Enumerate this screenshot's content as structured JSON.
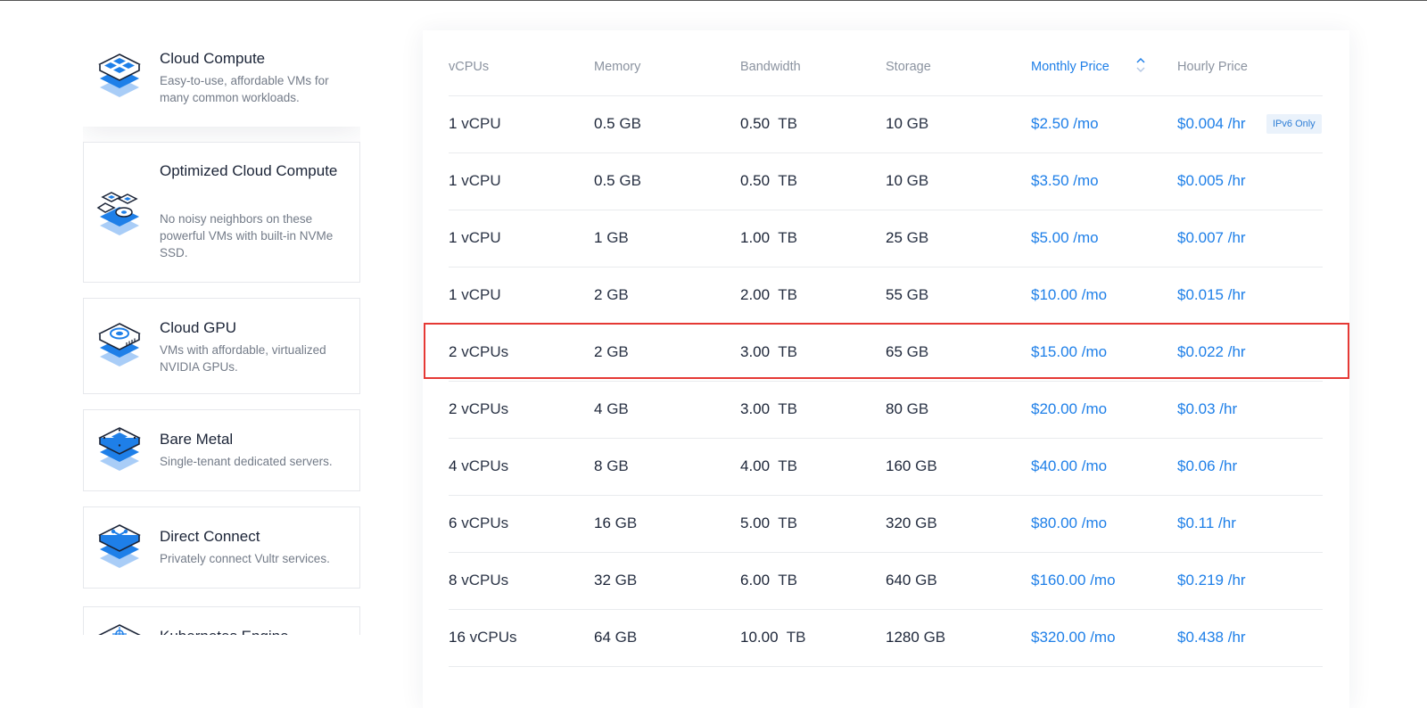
{
  "sidebar": {
    "items": [
      {
        "title": "Cloud Compute",
        "description": "Easy-to-use, affordable VMs for many common workloads.",
        "icon": "cloud-compute-icon",
        "active": true
      },
      {
        "title": "Optimized Cloud Compute",
        "description": "No noisy neighbors on these powerful VMs with built-in NVMe SSD.",
        "icon": "optimized-compute-icon",
        "active": false
      },
      {
        "title": "Cloud GPU",
        "description": "VMs with affordable, virtualized NVIDIA GPUs.",
        "icon": "gpu-icon",
        "active": false
      },
      {
        "title": "Bare Metal",
        "description": "Single-tenant dedicated servers.",
        "icon": "bare-metal-icon",
        "active": false
      },
      {
        "title": "Direct Connect",
        "description": "Privately connect Vultr services.",
        "icon": "direct-connect-icon",
        "active": false
      },
      {
        "title": "Kubernetes Engine",
        "description": "",
        "icon": "kubernetes-icon",
        "active": false
      }
    ]
  },
  "table": {
    "headers": {
      "vcpus": "vCPUs",
      "memory": "Memory",
      "bandwidth": "Bandwidth",
      "storage": "Storage",
      "monthly": "Monthly Price",
      "hourly": "Hourly Price"
    },
    "sorted_column": "monthly",
    "rows": [
      {
        "vcpu": "1",
        "vcpu_unit": "vCPU",
        "mem": "0.5",
        "mem_unit": "GB",
        "bw": "0.50",
        "bw_unit": "TB",
        "storage": "10",
        "storage_unit": "GB",
        "monthly": "$2.50",
        "monthly_unit": "/mo",
        "hourly": "$0.004",
        "hourly_unit": "/hr",
        "badge": "IPv6 Only"
      },
      {
        "vcpu": "1",
        "vcpu_unit": "vCPU",
        "mem": "0.5",
        "mem_unit": "GB",
        "bw": "0.50",
        "bw_unit": "TB",
        "storage": "10",
        "storage_unit": "GB",
        "monthly": "$3.50",
        "monthly_unit": "/mo",
        "hourly": "$0.005",
        "hourly_unit": "/hr",
        "badge": ""
      },
      {
        "vcpu": "1",
        "vcpu_unit": "vCPU",
        "mem": "1",
        "mem_unit": "GB",
        "bw": "1.00",
        "bw_unit": "TB",
        "storage": "25",
        "storage_unit": "GB",
        "monthly": "$5.00",
        "monthly_unit": "/mo",
        "hourly": "$0.007",
        "hourly_unit": "/hr",
        "badge": ""
      },
      {
        "vcpu": "1",
        "vcpu_unit": "vCPU",
        "mem": "2",
        "mem_unit": "GB",
        "bw": "2.00",
        "bw_unit": "TB",
        "storage": "55",
        "storage_unit": "GB",
        "monthly": "$10.00",
        "monthly_unit": "/mo",
        "hourly": "$0.015",
        "hourly_unit": "/hr",
        "badge": ""
      },
      {
        "vcpu": "2",
        "vcpu_unit": "vCPUs",
        "mem": "2",
        "mem_unit": "GB",
        "bw": "3.00",
        "bw_unit": "TB",
        "storage": "65",
        "storage_unit": "GB",
        "monthly": "$15.00",
        "monthly_unit": "/mo",
        "hourly": "$0.022",
        "hourly_unit": "/hr",
        "badge": "",
        "highlighted": true
      },
      {
        "vcpu": "2",
        "vcpu_unit": "vCPUs",
        "mem": "4",
        "mem_unit": "GB",
        "bw": "3.00",
        "bw_unit": "TB",
        "storage": "80",
        "storage_unit": "GB",
        "monthly": "$20.00",
        "monthly_unit": "/mo",
        "hourly": "$0.03",
        "hourly_unit": "/hr",
        "badge": ""
      },
      {
        "vcpu": "4",
        "vcpu_unit": "vCPUs",
        "mem": "8",
        "mem_unit": "GB",
        "bw": "4.00",
        "bw_unit": "TB",
        "storage": "160",
        "storage_unit": "GB",
        "monthly": "$40.00",
        "monthly_unit": "/mo",
        "hourly": "$0.06",
        "hourly_unit": "/hr",
        "badge": ""
      },
      {
        "vcpu": "6",
        "vcpu_unit": "vCPUs",
        "mem": "16",
        "mem_unit": "GB",
        "bw": "5.00",
        "bw_unit": "TB",
        "storage": "320",
        "storage_unit": "GB",
        "monthly": "$80.00",
        "monthly_unit": "/mo",
        "hourly": "$0.11",
        "hourly_unit": "/hr",
        "badge": ""
      },
      {
        "vcpu": "8",
        "vcpu_unit": "vCPUs",
        "mem": "32",
        "mem_unit": "GB",
        "bw": "6.00",
        "bw_unit": "TB",
        "storage": "640",
        "storage_unit": "GB",
        "monthly": "$160.00",
        "monthly_unit": "/mo",
        "hourly": "$0.219",
        "hourly_unit": "/hr",
        "badge": ""
      },
      {
        "vcpu": "16",
        "vcpu_unit": "vCPUs",
        "mem": "64",
        "mem_unit": "GB",
        "bw": "10.00",
        "bw_unit": "TB",
        "storage": "1280",
        "storage_unit": "GB",
        "monthly": "$320.00",
        "monthly_unit": "/mo",
        "hourly": "$0.438",
        "hourly_unit": "/hr",
        "badge": ""
      }
    ]
  },
  "colors": {
    "accent": "#1e7fe8",
    "highlight": "#e53935",
    "text": "#1b2437",
    "muted": "#8b93a0"
  }
}
